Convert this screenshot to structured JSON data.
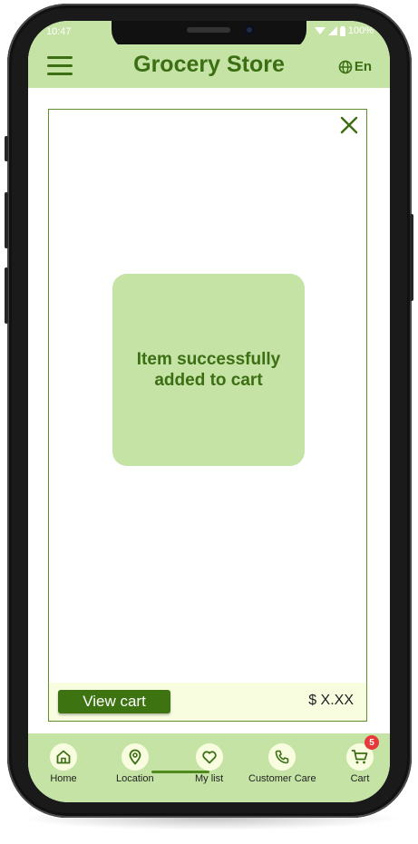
{
  "status_bar": {
    "time": "10:47",
    "battery": "100%"
  },
  "header": {
    "title": "Grocery Store",
    "language": "En"
  },
  "modal": {
    "message": "Item successfully added to cart",
    "view_cart_label": "View cart",
    "total": "$ X.XX"
  },
  "nav": {
    "items": [
      {
        "label": "Home",
        "icon": "home-icon"
      },
      {
        "label": "Location",
        "icon": "location-pin-icon"
      },
      {
        "label": "My list",
        "icon": "heart-icon",
        "active": true
      },
      {
        "label": "Customer Care",
        "icon": "phone-icon"
      },
      {
        "label": "Cart",
        "icon": "cart-icon",
        "badge": "5"
      }
    ]
  },
  "colors": {
    "accent": "#3c6e14",
    "header_bg": "#c4e3a4",
    "footer_bg": "#f9fde0",
    "badge": "#e5393a"
  }
}
